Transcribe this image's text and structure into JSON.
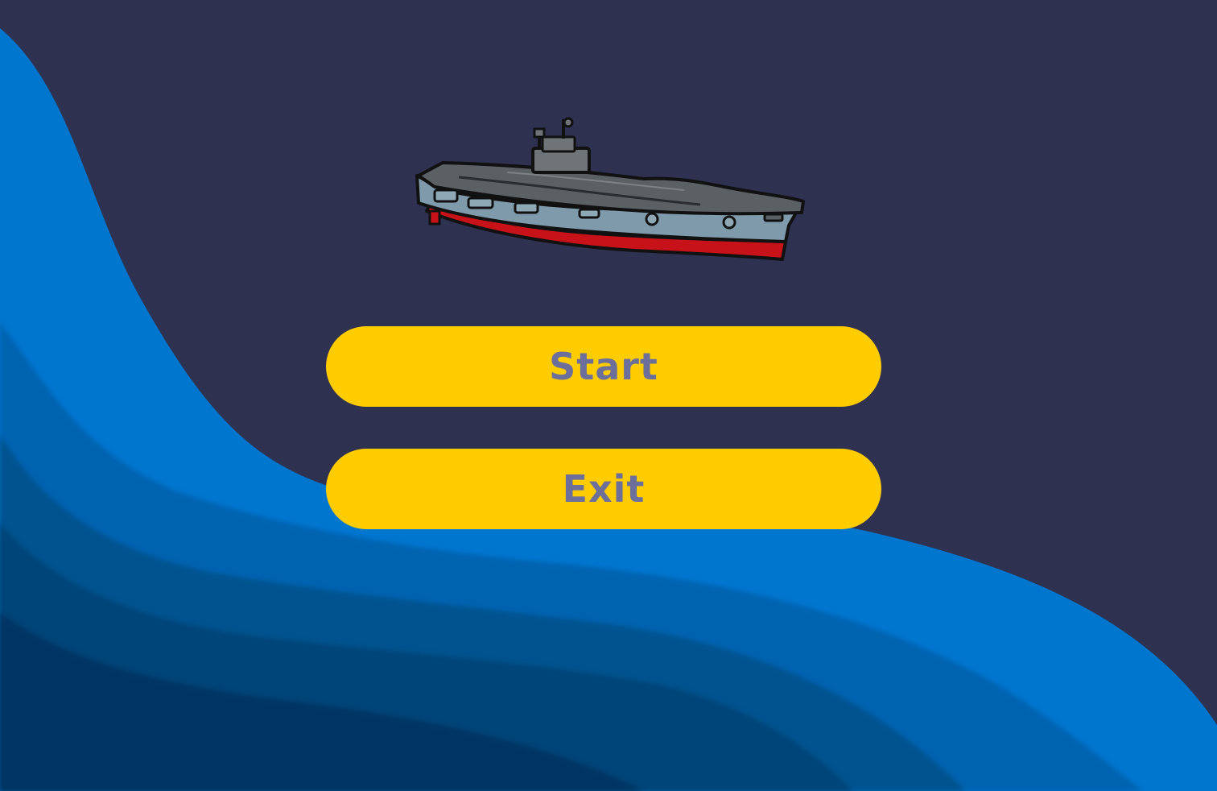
{
  "screen": "main-menu",
  "colors": {
    "background": "#2f3150",
    "button_fill": "#ffcc00",
    "button_text": "#6b6f99",
    "wave_light": "#0074cc",
    "wave_mid": "#005a9e",
    "wave_dark": "#003a66",
    "ship_hull_red": "#c8121a",
    "ship_deck_gray": "#5b6064",
    "ship_side_blue": "#7f9aaa"
  },
  "logo": {
    "icon": "aircraft-carrier-icon"
  },
  "menu": {
    "start_label": "Start",
    "exit_label": "Exit"
  }
}
